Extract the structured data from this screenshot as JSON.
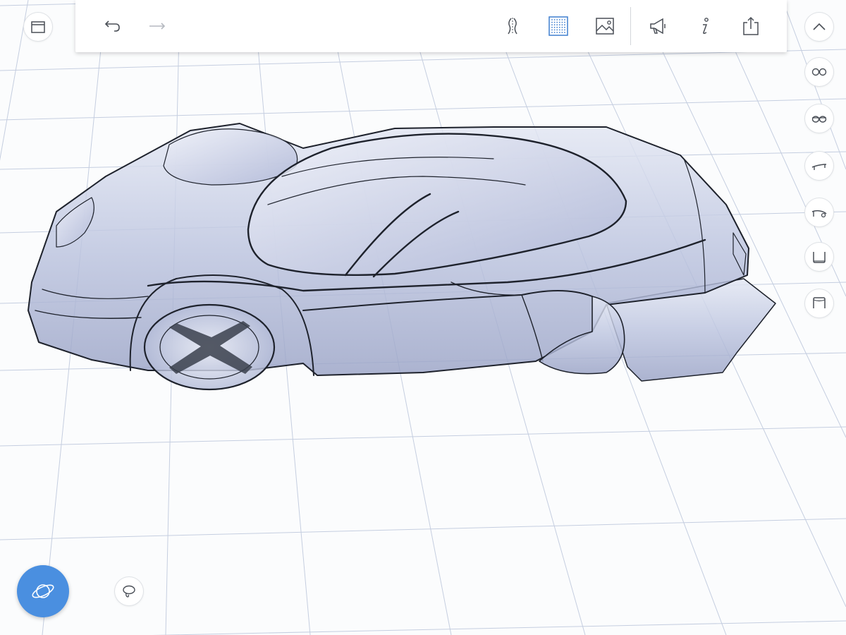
{
  "app": {
    "viewport": "3d-car-model-with-grid"
  },
  "toolbar": {
    "left_buttons": [
      {
        "name": "undo-button",
        "icon": "undo-arrow-icon"
      },
      {
        "name": "redo-button",
        "icon": "redo-arrow-icon"
      }
    ],
    "right_buttons": [
      {
        "name": "symmetry-button",
        "icon": "symmetry-icon"
      },
      {
        "name": "grid-button",
        "icon": "grid-dots-icon",
        "active": true
      },
      {
        "name": "reference-image-button",
        "icon": "image-icon"
      },
      {
        "name": "announce-button",
        "icon": "megaphone-icon"
      },
      {
        "name": "info-button",
        "icon": "info-icon"
      },
      {
        "name": "share-button",
        "icon": "share-export-icon"
      }
    ]
  },
  "side_panel": {
    "top_left": {
      "name": "layers-button",
      "icon": "window-icon"
    },
    "right_column": [
      {
        "name": "collapse-button",
        "icon": "chevron-up-icon"
      },
      {
        "name": "view-glasses-round-button",
        "icon": "glasses-round-icon"
      },
      {
        "name": "view-glasses-oval-button",
        "icon": "glasses-oval-icon"
      },
      {
        "name": "view-side-profile-button",
        "icon": "side-profile-icon"
      },
      {
        "name": "view-side-wheel-button",
        "icon": "side-wheel-icon"
      },
      {
        "name": "view-bottom-button",
        "icon": "bottom-frame-icon"
      },
      {
        "name": "view-top-button",
        "icon": "top-frame-icon"
      }
    ]
  },
  "bottom_tools": [
    {
      "name": "orbit-button",
      "icon": "orbit-planet-icon",
      "active": true
    },
    {
      "name": "lasso-button",
      "icon": "lasso-icon"
    }
  ],
  "colors": {
    "accent": "#4a8fe0",
    "icon": "#4a4f57",
    "active_icon": "#3f7fcf",
    "grid": "#c5cee0",
    "car_body": "#c4cbe3"
  }
}
